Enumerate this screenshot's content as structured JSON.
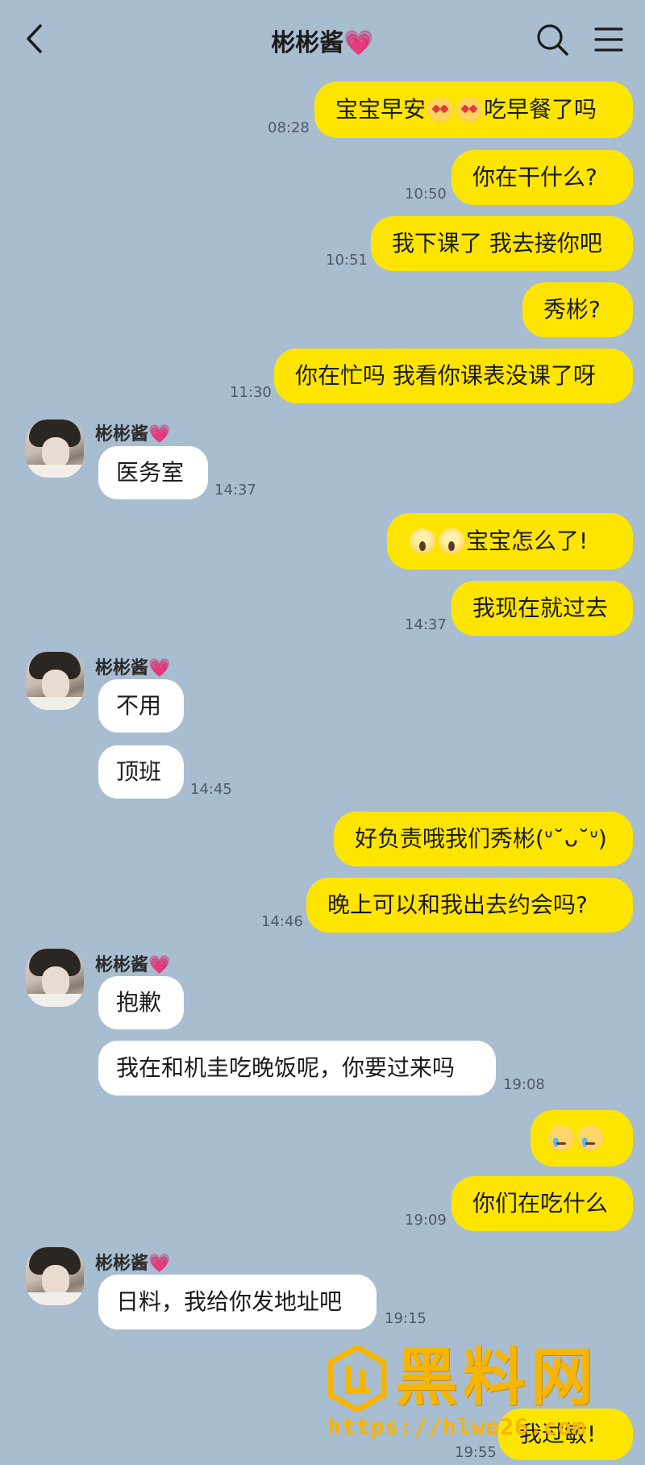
{
  "header": {
    "title": "彬彬酱💗",
    "icons": {
      "back": "chevron-left-icon",
      "search": "search-icon",
      "menu": "menu-icon"
    }
  },
  "colors": {
    "background": "#a9bdd0",
    "outgoing": "#fee500",
    "incoming": "#ffffff"
  },
  "messages": {
    "m1_text": "宝宝早安",
    "m1_suffix": "吃早餐了吗",
    "m1_time": "08:28",
    "m2_text": "你在干什么?",
    "m2_time": "10:50",
    "m3_text": "我下课了 我去接你吧",
    "m3_time": "10:51",
    "m4_text": "秀彬?",
    "m5_text": "你在忙吗 我看你课表没课了呀",
    "m5_time": "11:30",
    "g1_sender": "彬彬酱💗",
    "g1_m1": "医务室",
    "g1_time": "14:37",
    "m6_text": "宝宝怎么了!",
    "m7_text": "我现在就过去",
    "m7_time": "14:37",
    "g2_sender": "彬彬酱💗",
    "g2_m1": "不用",
    "g2_m2": "顶班",
    "g2_time": "14:45",
    "m8_text": "好负责哦我们秀彬(ᐡ˘ᴗ˘ᐡ)",
    "m9_text": "晚上可以和我出去约会吗?",
    "m9_time": "14:46",
    "g3_sender": "彬彬酱💗",
    "g3_m1": "抱歉",
    "g3_m2": "我在和机圭吃晚饭呢，你要过来吗",
    "g3_time": "19:08",
    "m11_text": "你们在吃什么",
    "m11_time": "19:09",
    "g4_sender": "彬彬酱💗",
    "g4_m1": "日料，我给你发地址吧",
    "g4_time": "19:15",
    "m12_text": "我过敏!",
    "m12_time": "19:55"
  },
  "watermark": {
    "text": "黑料网",
    "url": "https://hlwe26.com"
  }
}
